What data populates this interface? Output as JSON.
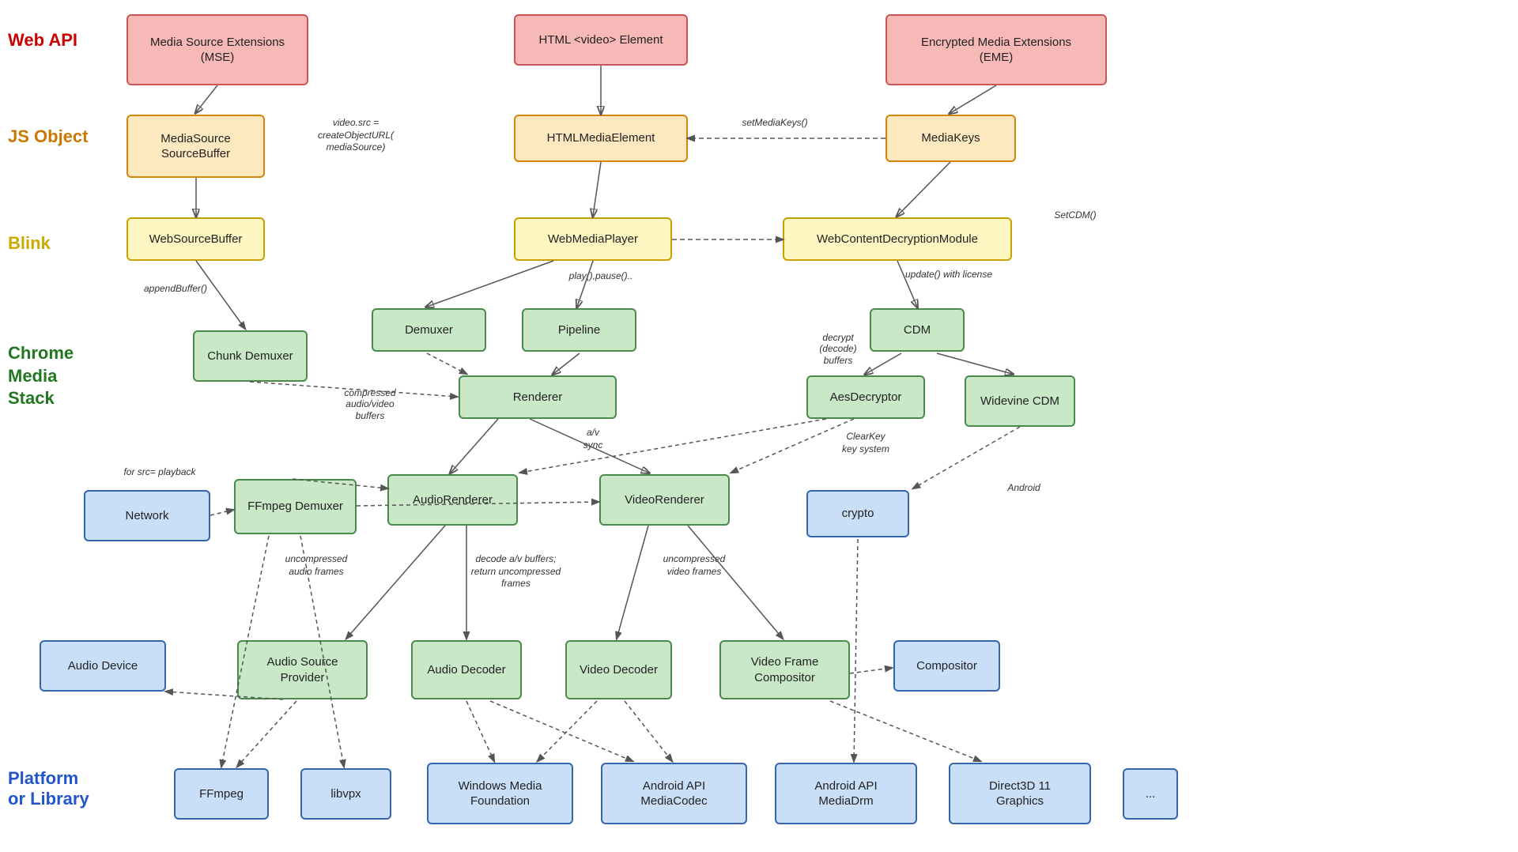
{
  "layers": {
    "web_api": "Web API",
    "js_object": "JS Object",
    "blink": "Blink",
    "chrome_media_stack": "Chrome\nMedia\nStack",
    "platform_or_library": "Platform\nor Library"
  },
  "boxes": {
    "mse": "Media Source Extensions\n(MSE)",
    "html_video": "HTML <video> Element",
    "eme": "Encrypted Media Extensions\n(EME)",
    "mediasource_sourcebuffer": "MediaSource\nSourceBuffer",
    "htmlmediaelement": "HTMLMediaElement",
    "mediakeys": "MediaKeys",
    "websourcebuffer": "WebSourceBuffer",
    "webmediaplayer": "WebMediaPlayer",
    "webcontentdecryptionmodule": "WebContentDecryptionModule",
    "chunk_demuxer": "Chunk\nDemuxer",
    "demuxer": "Demuxer",
    "pipeline": "Pipeline",
    "cdm": "CDM",
    "renderer": "Renderer",
    "aesdecryptor": "AesDecryptor",
    "widevine_cdm": "Widevine\nCDM",
    "network": "Network",
    "ffmpeg_demuxer": "FFmpeg\nDemuxer",
    "audiorenderer": "AudioRenderer",
    "videorenderer": "VideoRenderer",
    "crypto": "crypto",
    "audio_device": "Audio Device",
    "audio_source_provider": "Audio Source\nProvider",
    "audio_decoder": "Audio\nDecoder",
    "video_decoder": "Video\nDecoder",
    "video_frame_compositor": "Video Frame\nCompositor",
    "compositor": "Compositor",
    "ffmpeg": "FFmpeg",
    "libvpx": "libvpx",
    "windows_media_foundation": "Windows Media\nFoundation",
    "android_api_mediacodec": "Android API\nMediaCodec",
    "android_api_mediadrm": "Android API\nMediaDrm",
    "direct3d_11_graphics": "Direct3D 11\nGraphics",
    "ellipsis": "..."
  },
  "annotations": {
    "video_src": "video.src =\ncreateObjectURL(\nmediaSource)",
    "set_media_keys": "setMediaKeys()",
    "set_cdm": "SetCDM()",
    "update_with_license": "update() with license",
    "append_buffer": "appendBuffer()",
    "play_pause": "play(),pause()..",
    "decrypt_decode_buffers": "decrypt\n(decode)\nbuffers",
    "compressed_audio_video_buffers": "compressed\naudio/video\nbuffers",
    "for_src_playback": "for src= playback",
    "a_v_sync": "a/v\nsync",
    "decode_av_buffers": "decode a/v buffers;\nreturn uncompressed\nframes",
    "uncompressed_audio_frames": "uncompressed\naudio frames",
    "uncompressed_video_frames": "uncompressed\nvideo frames",
    "clearkey_key_system": "ClearKey\nkey system",
    "android": "Android"
  }
}
